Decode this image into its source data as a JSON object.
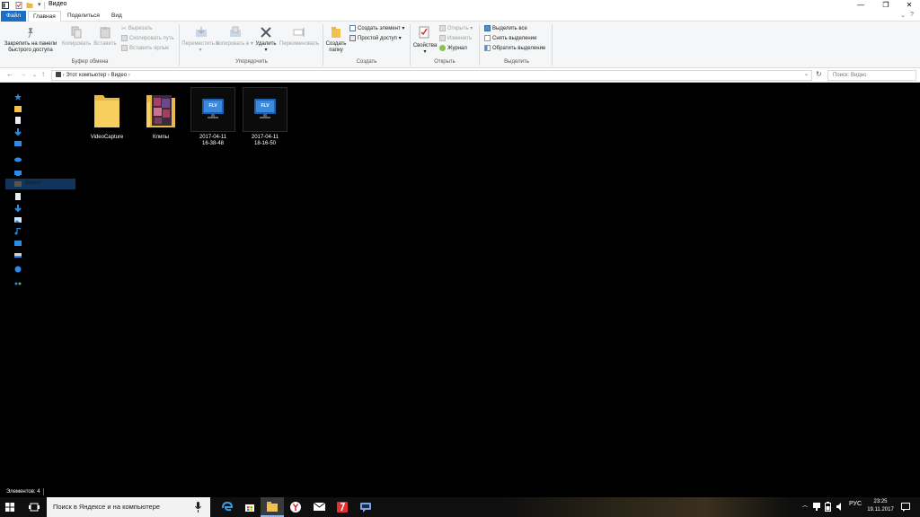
{
  "window": {
    "title": "Видео"
  },
  "ribbon_tabs": [
    "Файл",
    "Главная",
    "Поделиться",
    "Вид"
  ],
  "ribbon": {
    "clipboard": {
      "pin": "Закрепить на панели быстрого доступа",
      "copy": "Копировать",
      "paste": "Вставить",
      "cut": "Вырезать",
      "copy_path": "Скопировать путь",
      "paste_shortcut": "Вставить ярлык",
      "group": "Буфер обмена"
    },
    "organize": {
      "move_to": "Переместить в",
      "copy_to": "Копировать в",
      "delete": "Удалить",
      "rename": "Переименовать",
      "group": "Упорядочить"
    },
    "create": {
      "new_folder": "Создать папку",
      "new_item": "Создать элемент",
      "easy_access": "Простой доступ",
      "group": "Создать"
    },
    "open": {
      "properties": "Свойства",
      "open": "Открыть",
      "edit": "Изменить",
      "history": "Журнал",
      "group": "Открыть"
    },
    "select": {
      "select_all": "Выделить все",
      "select_none": "Снять выделение",
      "invert": "Обратить выделение",
      "group": "Выделить"
    }
  },
  "address": {
    "path": [
      "Этот компьютер",
      "Видео"
    ],
    "search_placeholder": "Поиск: Видео"
  },
  "nav_selected_label": "Видео",
  "files": [
    {
      "name": "VideoCapture",
      "type": "folder"
    },
    {
      "name": "Клипы",
      "type": "folder-thumbs"
    },
    {
      "name_line1": "2017-04-11",
      "name_line2": "16-38-48",
      "type": "flv"
    },
    {
      "name_line1": "2017-04-11",
      "name_line2": "18-16-50",
      "type": "flv"
    }
  ],
  "flv_badge": "FLV",
  "status": {
    "count": "Элементов: 4"
  },
  "taskbar": {
    "search_placeholder": "Поиск в Яндексе и на компьютере",
    "language": "РУС",
    "time": "23:25",
    "date": "19.11.2017"
  },
  "colors": {
    "accent": "#1a6fc4",
    "selection": "#13345a",
    "folder": "#e8b84a"
  }
}
